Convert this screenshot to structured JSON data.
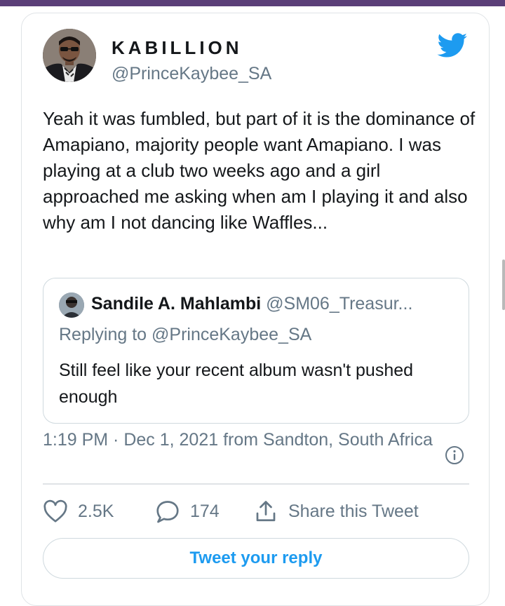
{
  "tweet": {
    "display_name": "KABILLION",
    "handle": "@PrinceKaybee_SA",
    "text": "Yeah it was fumbled, but part of it is the dominance of Amapiano, majority people want Amapiano. I was playing at a club two weeks ago and a girl approached me asking when am I playing it and also why am I not dancing like Waffles...",
    "timestamp": "1:19 PM · Dec 1, 2021 from Sandton, South Africa"
  },
  "quoted": {
    "name": "Sandile A. Mahlambi",
    "handle": "@SM06_Treasur...",
    "replying_to": "Replying to @PrinceKaybee_SA",
    "text": "Still feel like your recent album wasn't pushed enough"
  },
  "actions": {
    "likes": "2.5K",
    "replies": "174",
    "share_label": "Share this Tweet"
  },
  "reply_button_label": "Tweet your reply",
  "icons": {
    "brand": "twitter-bird-icon",
    "info": "info-icon",
    "like": "heart-icon",
    "reply": "comment-bubble-icon",
    "share": "share-icon"
  },
  "colors": {
    "accent": "#1d9bf0",
    "secondary_text": "#657786",
    "top_bar": "#5b3f78"
  }
}
